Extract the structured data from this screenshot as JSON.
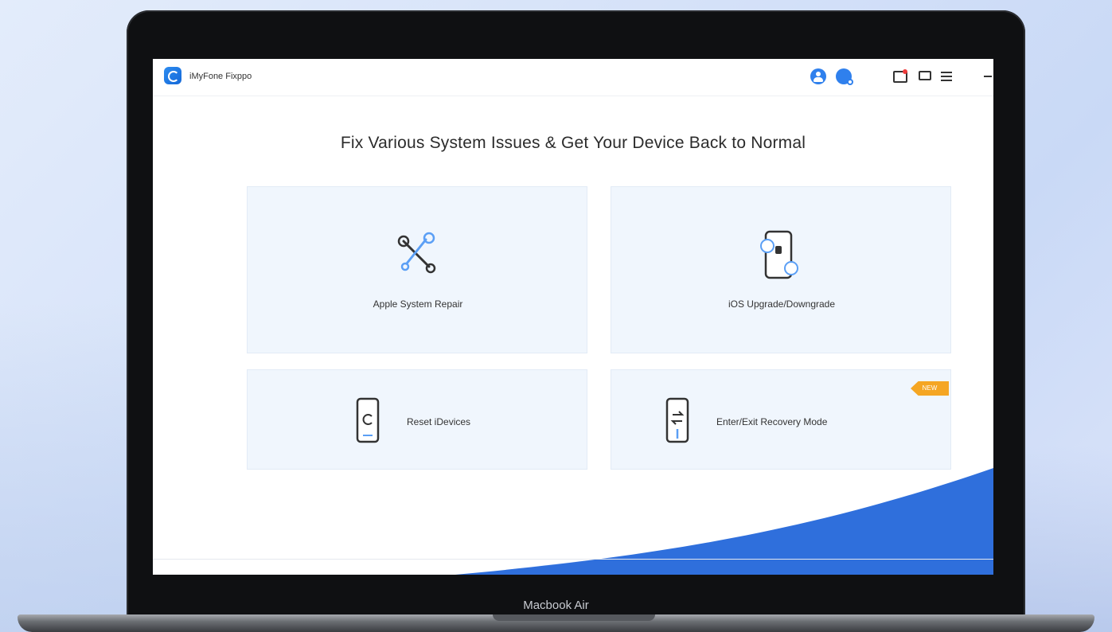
{
  "app": {
    "name": "iMyFone Fixppo"
  },
  "toolbar": {
    "icons": [
      "user-icon",
      "search-user-icon",
      "mail-icon",
      "chat-icon",
      "menu-icon",
      "minimize-icon"
    ]
  },
  "main": {
    "headline": "Fix Various System Issues & Get Your Device Back to Normal",
    "cards": [
      {
        "label": "Apple System Repair",
        "icon": "repair-tools-icon"
      },
      {
        "label": "iOS Upgrade/Downgrade",
        "icon": "phone-upgrade-icon"
      },
      {
        "label": "Reset iDevices",
        "icon": "phone-reset-icon"
      },
      {
        "label": "Enter/Exit Recovery Mode",
        "icon": "phone-recovery-icon",
        "badge": "NEW"
      }
    ]
  },
  "device": {
    "label": "Macbook Air"
  },
  "colors": {
    "accent": "#2f80ed",
    "card_bg": "#f0f6fd",
    "badge": "#f5a623",
    "bezel": "#0f1012"
  }
}
